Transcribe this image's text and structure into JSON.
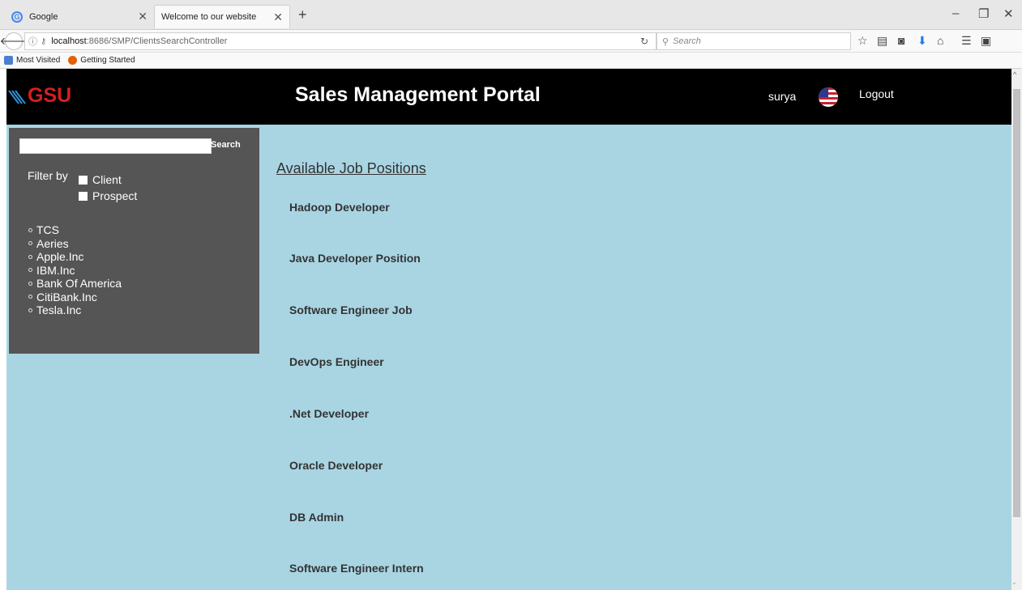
{
  "browser": {
    "tabs": [
      {
        "favicon": "G",
        "title": "Google"
      },
      {
        "title": "Welcome to our website"
      }
    ],
    "new_tab": "+",
    "url_host": "localhost",
    "url_rest": ":8686/SMP/ClientsSearchController",
    "search_placeholder": "Search",
    "bookmarks": [
      "Most Visited",
      "Getting Started"
    ]
  },
  "header": {
    "logo_text": "GSU",
    "title": "Sales Management Portal",
    "username": "surya",
    "logout_label": "Logout"
  },
  "sidebar": {
    "search_button": "Search",
    "filter_label": "Filter by",
    "filters": [
      "Client",
      "Prospect"
    ],
    "clients": [
      "TCS",
      "Aeries",
      "Apple.Inc",
      "IBM.Inc",
      "Bank Of America",
      "CitiBank.Inc",
      "Tesla.Inc"
    ]
  },
  "main": {
    "heading": "Available Job Positions",
    "jobs": [
      "Hadoop Developer",
      "Java Developer Position",
      "Software Engineer Job",
      "DevOps Engineer",
      ".Net Developer",
      "Oracle Developer",
      "DB Admin",
      "Software Engineer Intern"
    ]
  },
  "colors": {
    "page_bg": "#a9d5e3",
    "header_bg": "#000000",
    "sidebar_bg": "#555555",
    "logo": "#d41f1f"
  }
}
